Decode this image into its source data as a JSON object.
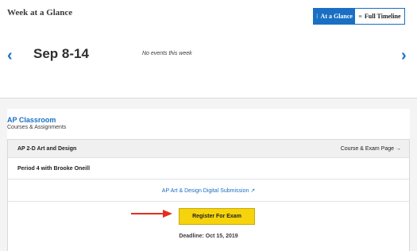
{
  "week": {
    "title": "Week at a Glance",
    "toggle": {
      "at_a_glance_icon": "⁝",
      "at_a_glance": "At a Glance",
      "full_timeline_icon": "≡",
      "full_timeline": "Full Timeline"
    },
    "prev_icon": "‹",
    "next_icon": "›",
    "date_range": "Sep 8-14",
    "no_events": "No events this week"
  },
  "ap_classroom": {
    "title": "AP Classroom",
    "subtitle": "Courses & Assignments",
    "course": {
      "name": "AP 2-D Art and Design",
      "exam_page_link": "Course & Exam Page →",
      "period": "Period 4 with Brooke Oneill",
      "digital_submission": "AP Art & Design Digital Submission ↗",
      "register_button": "Register For Exam",
      "deadline": "Deadline: Oct 15, 2019"
    }
  },
  "colors": {
    "accent": "#1a6fc4",
    "register_button": "#f6d30c",
    "arrow": "#e0301e"
  },
  "icons": {
    "annotation_arrow": "right-arrow-icon"
  }
}
